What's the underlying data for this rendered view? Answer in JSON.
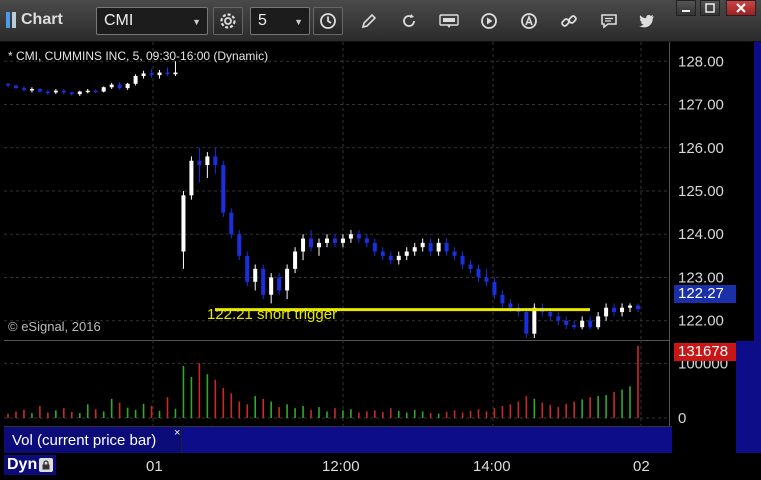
{
  "toolbar": {
    "app_title": "Chart",
    "symbol_value": "CMI",
    "interval_value": "5",
    "icons": [
      "settings-icon",
      "clock-icon",
      "pencil-icon",
      "refresh-icon",
      "quote-icon",
      "play-icon",
      "alert-icon",
      "link-icon",
      "chat-icon",
      "twitter-icon"
    ]
  },
  "window": {
    "controls": [
      "minimize-icon",
      "maximize-icon",
      "close-icon"
    ]
  },
  "chart": {
    "label": "* CMI, CUMMINS INC, 5, 09:30-16:00 (Dynamic)",
    "copyright": "© eSignal, 2016",
    "annotation": "122.21 short trigger",
    "last_price": "122.27",
    "last_volume": "131678",
    "study_label": "Vol (current price bar)",
    "close_mark": "×",
    "mode": "Dyn",
    "price_axis": [
      "128.00",
      "127.00",
      "126.00",
      "125.00",
      "124.00",
      "123.00",
      "122.00"
    ],
    "volume_axis": [
      "100000",
      "0"
    ],
    "time_axis": [
      "01",
      "12:00",
      "14:00",
      "02"
    ],
    "colors": {
      "up": "#ffffff",
      "down": "#1a2fe0",
      "trigger_line": "#e8e800",
      "vol_up": "#2faa2f",
      "vol_down": "#c82a2a"
    }
  },
  "chart_data": {
    "type": "candlestick",
    "ylim": [
      121.6,
      128.4
    ],
    "trigger_level": 122.21,
    "bars": [
      [
        127.48,
        127.5,
        127.4,
        127.44
      ],
      [
        127.44,
        127.46,
        127.36,
        127.38
      ],
      [
        127.38,
        127.42,
        127.3,
        127.34
      ],
      [
        127.34,
        127.4,
        127.28,
        127.36
      ],
      [
        127.36,
        127.38,
        127.26,
        127.3
      ],
      [
        127.3,
        127.34,
        127.22,
        127.28
      ],
      [
        127.28,
        127.36,
        127.24,
        127.32
      ],
      [
        127.32,
        127.36,
        127.24,
        127.28
      ],
      [
        127.28,
        127.3,
        127.2,
        127.24
      ],
      [
        127.24,
        127.32,
        127.2,
        127.3
      ],
      [
        127.3,
        127.36,
        127.26,
        127.32
      ],
      [
        127.32,
        127.34,
        127.26,
        127.3
      ],
      [
        127.3,
        127.42,
        127.28,
        127.4
      ],
      [
        127.4,
        127.5,
        127.36,
        127.46
      ],
      [
        127.46,
        127.52,
        127.34,
        127.38
      ],
      [
        127.38,
        127.5,
        127.34,
        127.48
      ],
      [
        127.48,
        127.7,
        127.44,
        127.66
      ],
      [
        127.66,
        127.78,
        127.6,
        127.72
      ],
      [
        127.72,
        127.82,
        127.62,
        127.68
      ],
      [
        127.68,
        127.8,
        127.6,
        127.74
      ],
      [
        127.74,
        127.86,
        127.66,
        127.7
      ],
      [
        127.7,
        128.0,
        127.66,
        127.74
      ],
      [
        123.6,
        125.0,
        123.2,
        124.9
      ],
      [
        124.9,
        125.8,
        124.8,
        125.7
      ],
      [
        125.7,
        126.0,
        125.2,
        125.6
      ],
      [
        125.6,
        125.9,
        125.3,
        125.8
      ],
      [
        125.8,
        126.0,
        125.4,
        125.6
      ],
      [
        125.6,
        125.7,
        124.4,
        124.5
      ],
      [
        124.5,
        124.6,
        123.9,
        124.0
      ],
      [
        124.0,
        124.1,
        123.4,
        123.5
      ],
      [
        123.5,
        123.6,
        122.8,
        122.9
      ],
      [
        122.9,
        123.3,
        122.7,
        123.2
      ],
      [
        123.2,
        123.3,
        122.5,
        122.6
      ],
      [
        122.6,
        123.1,
        122.4,
        123.0
      ],
      [
        123.0,
        123.1,
        122.6,
        122.7
      ],
      [
        122.7,
        123.3,
        122.5,
        123.2
      ],
      [
        123.2,
        123.7,
        123.1,
        123.6
      ],
      [
        123.6,
        124.0,
        123.4,
        123.9
      ],
      [
        123.9,
        124.1,
        123.6,
        123.7
      ],
      [
        123.7,
        123.9,
        123.5,
        123.8
      ],
      [
        123.8,
        124.0,
        123.7,
        123.9
      ],
      [
        123.9,
        124.0,
        123.7,
        123.8
      ],
      [
        123.8,
        124.0,
        123.7,
        123.9
      ],
      [
        123.9,
        124.1,
        123.8,
        124.0
      ],
      [
        124.0,
        124.1,
        123.8,
        123.9
      ],
      [
        123.9,
        124.0,
        123.7,
        123.8
      ],
      [
        123.8,
        123.9,
        123.5,
        123.6
      ],
      [
        123.6,
        123.7,
        123.4,
        123.5
      ],
      [
        123.5,
        123.6,
        123.3,
        123.4
      ],
      [
        123.4,
        123.6,
        123.3,
        123.5
      ],
      [
        123.5,
        123.7,
        123.4,
        123.6
      ],
      [
        123.6,
        123.8,
        123.5,
        123.7
      ],
      [
        123.7,
        123.9,
        123.6,
        123.8
      ],
      [
        123.8,
        123.9,
        123.5,
        123.6
      ],
      [
        123.6,
        123.9,
        123.5,
        123.8
      ],
      [
        123.8,
        123.9,
        123.5,
        123.6
      ],
      [
        123.6,
        123.7,
        123.4,
        123.5
      ],
      [
        123.5,
        123.6,
        123.2,
        123.3
      ],
      [
        123.3,
        123.4,
        123.1,
        123.2
      ],
      [
        123.2,
        123.3,
        122.9,
        123.0
      ],
      [
        123.0,
        123.2,
        122.8,
        122.9
      ],
      [
        122.9,
        123.0,
        122.5,
        122.6
      ],
      [
        122.6,
        122.7,
        122.3,
        122.4
      ],
      [
        122.4,
        122.5,
        122.2,
        122.3
      ],
      [
        122.3,
        122.4,
        122.1,
        122.2
      ],
      [
        122.2,
        122.3,
        121.6,
        121.7
      ],
      [
        121.7,
        122.4,
        121.6,
        122.3
      ],
      [
        122.3,
        122.4,
        122.1,
        122.2
      ],
      [
        122.2,
        122.3,
        122.0,
        122.1
      ],
      [
        122.1,
        122.2,
        121.9,
        122.0
      ],
      [
        122.0,
        122.1,
        121.8,
        121.9
      ],
      [
        121.9,
        122.0,
        121.8,
        121.85
      ],
      [
        121.85,
        122.1,
        121.8,
        122.0
      ],
      [
        122.0,
        122.1,
        121.8,
        121.85
      ],
      [
        121.85,
        122.2,
        121.8,
        122.1
      ],
      [
        122.1,
        122.4,
        122.0,
        122.3
      ],
      [
        122.3,
        122.4,
        122.1,
        122.2
      ],
      [
        122.2,
        122.4,
        122.1,
        122.3
      ],
      [
        122.3,
        122.4,
        122.2,
        122.35
      ],
      [
        122.35,
        122.4,
        122.2,
        122.27
      ]
    ],
    "volume": [
      8000,
      12000,
      15000,
      9000,
      22000,
      10000,
      14000,
      18000,
      11000,
      9000,
      25000,
      16000,
      12000,
      35000,
      28000,
      19000,
      15000,
      26000,
      22000,
      13000,
      38000,
      17000,
      95000,
      75000,
      100000,
      80000,
      70000,
      55000,
      45000,
      30000,
      25000,
      40000,
      35000,
      30000,
      20000,
      25000,
      18000,
      22000,
      15000,
      20000,
      12000,
      18000,
      14000,
      16000,
      10000,
      12000,
      14000,
      11000,
      18000,
      13000,
      10000,
      15000,
      12000,
      9000,
      8000,
      11000,
      14000,
      10000,
      13000,
      16000,
      12000,
      18000,
      22000,
      25000,
      30000,
      40000,
      35000,
      28000,
      24000,
      20000,
      26000,
      30000,
      34000,
      38000,
      40000,
      42000,
      48000,
      52000,
      58000,
      131678
    ]
  }
}
